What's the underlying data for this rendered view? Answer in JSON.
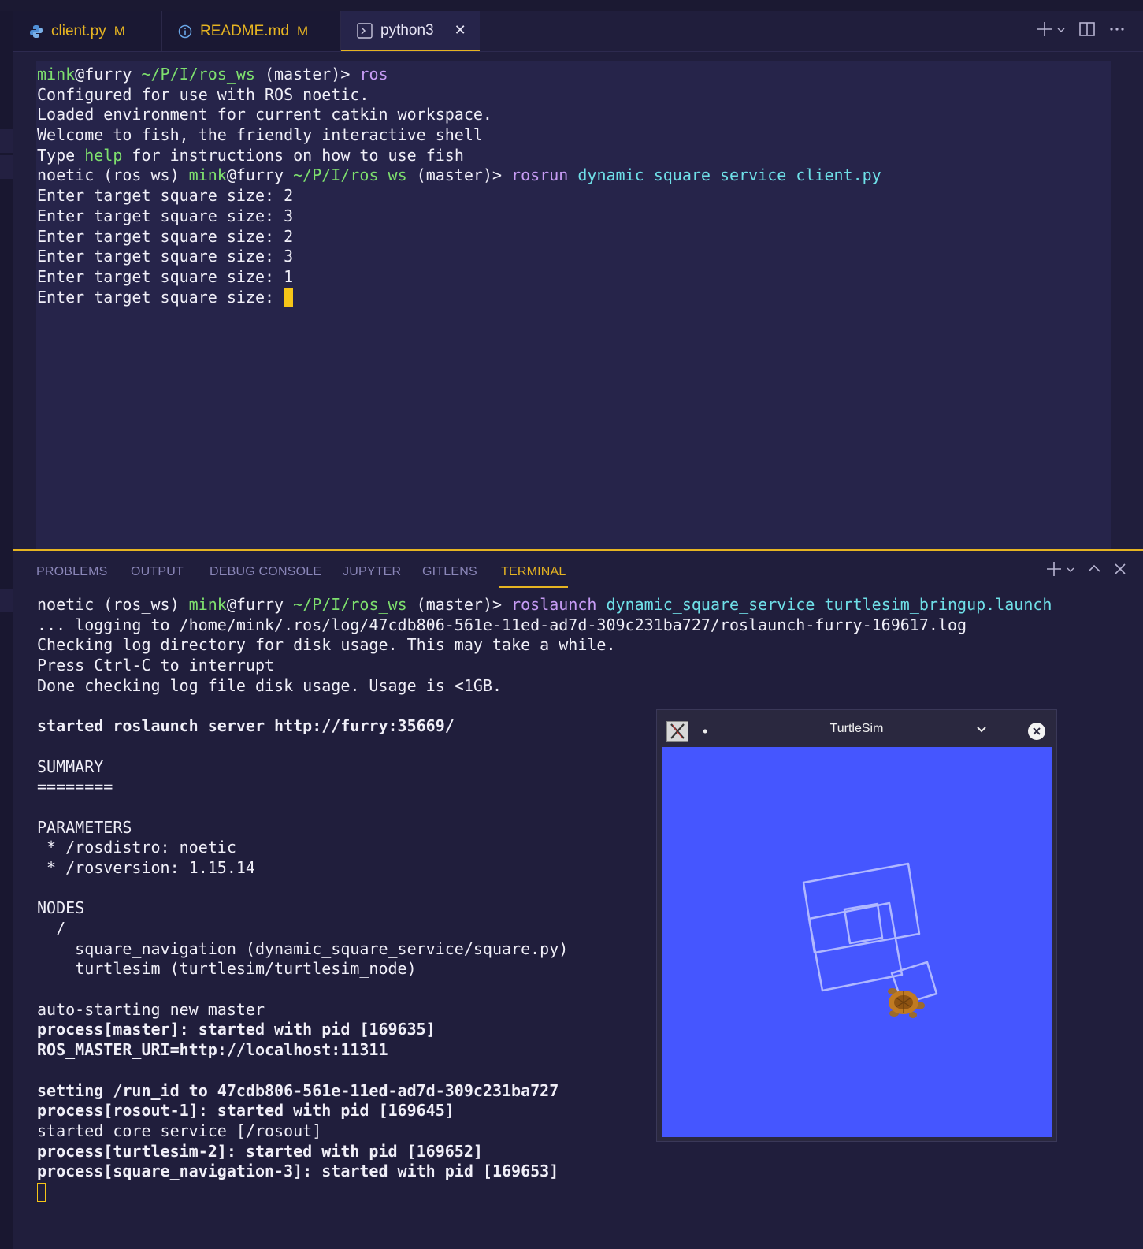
{
  "tabs": [
    {
      "label": "client.py",
      "modified": "M",
      "icon": "python-icon"
    },
    {
      "label": "README.md",
      "modified": "M",
      "icon": "info-icon"
    },
    {
      "label": "python3",
      "icon": "terminal-icon",
      "close": "✕"
    }
  ],
  "editor_terminal": {
    "prompt1_user": "mink",
    "prompt1_host": "@furry",
    "prompt1_path": "~/P/I/ros_ws",
    "prompt1_branch": "(master)>",
    "prompt1_cmd": "ros",
    "l2": "Configured for use with ROS noetic.",
    "l3": "Loaded environment for current catkin workspace.",
    "l4": "Welcome to fish, the friendly interactive shell",
    "l5_a": "Type ",
    "l5_help": "help",
    "l5_b": " for instructions on how to use fish",
    "prompt2_env": "noetic (ros_ws) ",
    "prompt2_user": "mink",
    "prompt2_host": "@furry",
    "prompt2_path": "~/P/I/ros_ws",
    "prompt2_branch": "(master)>",
    "prompt2_cmd": "rosrun",
    "prompt2_args": "dynamic_square_service client.py",
    "inputs": [
      "Enter target square size: 2",
      "Enter target square size: 3",
      "Enter target square size: 2",
      "Enter target square size: 3",
      "Enter target square size: 1",
      "Enter target square size: "
    ]
  },
  "panel": {
    "tabs": [
      "PROBLEMS",
      "OUTPUT",
      "DEBUG CONSOLE",
      "JUPYTER",
      "GITLENS",
      "TERMINAL"
    ],
    "terminal": {
      "prompt_env": "noetic (ros_ws) ",
      "prompt_user": "mink",
      "prompt_host": "@furry",
      "prompt_path": "~/P/I/ros_ws",
      "prompt_branch": "(master)>",
      "cmd": "roslaunch",
      "args": "dynamic_square_service turtlesim_bringup.launch",
      "l2": "... logging to /home/mink/.ros/log/47cdb806-561e-11ed-ad7d-309c231ba727/roslaunch-furry-169617.log",
      "l3": "Checking log directory for disk usage. This may take a while.",
      "l4": "Press Ctrl-C to interrupt",
      "l5": "Done checking log file disk usage. Usage is <1GB.",
      "l7": "started roslaunch server http://furry:35669/",
      "l9": "SUMMARY",
      "l10": "========",
      "l12": "PARAMETERS",
      "l13": " * /rosdistro: noetic",
      "l14": " * /rosversion: 1.15.14",
      "l16": "NODES",
      "l17": "  /",
      "l18": "    square_navigation (dynamic_square_service/square.py)",
      "l19": "    turtlesim (turtlesim/turtlesim_node)",
      "l21": "auto-starting new master",
      "l22": "process[master]: started with pid [169635]",
      "l23": "ROS_MASTER_URI=http://localhost:11311",
      "l25": "setting /run_id to 47cdb806-561e-11ed-ad7d-309c231ba727",
      "l26": "process[rosout-1]: started with pid [169645]",
      "l27": "started core service [/rosout]",
      "l28": "process[turtlesim-2]: started with pid [169652]",
      "l29": "process[square_navigation-3]: started with pid [169653]"
    }
  },
  "turtlesim": {
    "title": "TurtleSim",
    "dot": "•",
    "background": "#4556ff"
  },
  "colors": {
    "accent": "#e6b422",
    "green": "#7ee06e",
    "purple": "#c79cf5",
    "cyan": "#6fe0e8"
  }
}
